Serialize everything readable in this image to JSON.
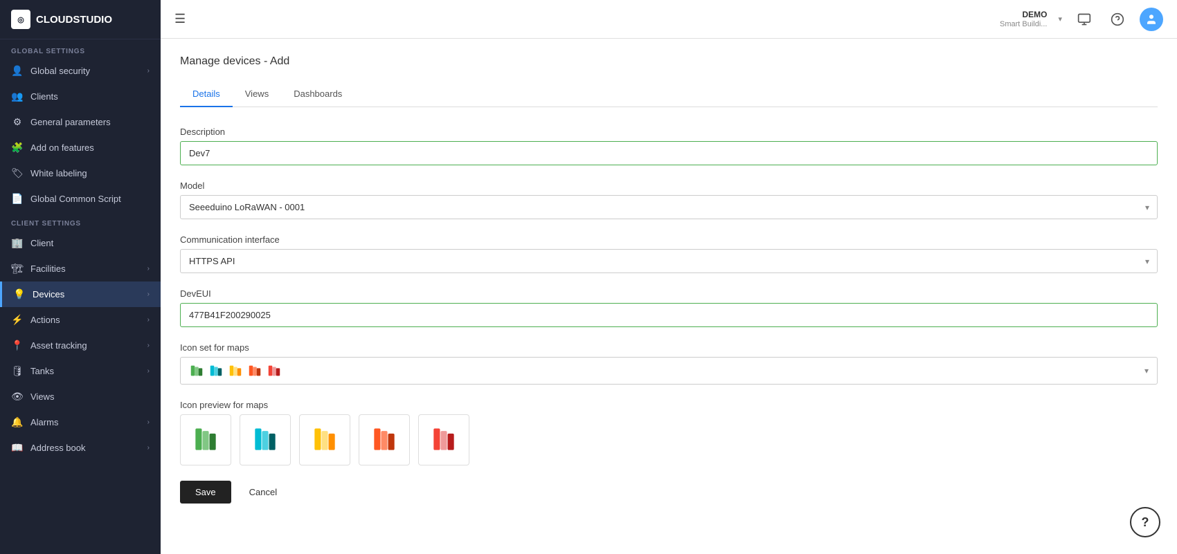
{
  "app": {
    "logo_text": "CLOUDSTUDIO",
    "logo_icon": "CS"
  },
  "topbar": {
    "hamburger_icon": "☰",
    "demo_label": "DEMO",
    "demo_sub": "Smart Buildi...",
    "monitor_icon": "🖥",
    "help_icon": "?",
    "dropdown_arrow": "▾"
  },
  "sidebar": {
    "global_settings_label": "GLOBAL SETTINGS",
    "client_settings_label": "CLIENT SETTINGS",
    "items_global": [
      {
        "id": "global-security",
        "icon": "👤",
        "label": "Global security",
        "has_chevron": true
      },
      {
        "id": "clients",
        "icon": "👥",
        "label": "Clients",
        "has_chevron": false
      },
      {
        "id": "general-parameters",
        "icon": "⚙",
        "label": "General parameters",
        "has_chevron": false
      },
      {
        "id": "add-on-features",
        "icon": "🧩",
        "label": "Add on features",
        "has_chevron": false
      },
      {
        "id": "white-labeling",
        "icon": "🏷",
        "label": "White labeling",
        "has_chevron": false
      },
      {
        "id": "global-common-script",
        "icon": "📄",
        "label": "Global Common Script",
        "has_chevron": false
      }
    ],
    "items_client": [
      {
        "id": "client",
        "icon": "🏢",
        "label": "Client",
        "has_chevron": false
      },
      {
        "id": "facilities",
        "icon": "🏗",
        "label": "Facilities",
        "has_chevron": true
      },
      {
        "id": "devices",
        "icon": "💡",
        "label": "Devices",
        "has_chevron": true,
        "active": true
      },
      {
        "id": "actions",
        "icon": "⚡",
        "label": "Actions",
        "has_chevron": true
      },
      {
        "id": "asset-tracking",
        "icon": "📍",
        "label": "Asset tracking",
        "has_chevron": true
      },
      {
        "id": "tanks",
        "icon": "🛢",
        "label": "Tanks",
        "has_chevron": true
      },
      {
        "id": "views",
        "icon": "👁",
        "label": "Views",
        "has_chevron": false
      },
      {
        "id": "alarms",
        "icon": "🔔",
        "label": "Alarms",
        "has_chevron": true
      },
      {
        "id": "address-book",
        "icon": "📖",
        "label": "Address book",
        "has_chevron": true
      }
    ]
  },
  "page": {
    "title": "Manage devices - Add",
    "tabs": [
      {
        "id": "details",
        "label": "Details",
        "active": true
      },
      {
        "id": "views",
        "label": "Views",
        "active": false
      },
      {
        "id": "dashboards",
        "label": "Dashboards",
        "active": false
      }
    ]
  },
  "form": {
    "description_label": "Description",
    "description_value": "Dev7",
    "model_label": "Model",
    "model_value": "Seeeduino LoRaWAN - 0001",
    "model_options": [
      "Seeeduino LoRaWAN - 0001"
    ],
    "comm_interface_label": "Communication interface",
    "comm_interface_value": "HTTPS API",
    "comm_options": [
      "HTTPS API"
    ],
    "deveui_label": "DevEUI",
    "deveui_value": "477B41F200290025",
    "icon_set_label": "Icon set for maps",
    "icon_preview_label": "Icon preview for maps",
    "save_label": "Save",
    "cancel_label": "Cancel"
  },
  "help_fab_label": "?"
}
